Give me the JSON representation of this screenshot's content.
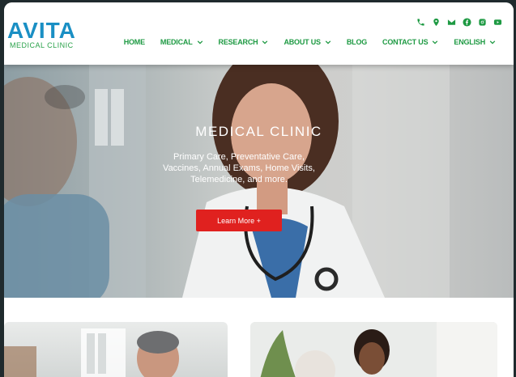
{
  "brand": {
    "logo_top": "AVITA",
    "logo_bottom": "MEDICAL CLINIC",
    "primary_color": "#1a8fc4",
    "accent_color": "#1e9a43"
  },
  "header": {
    "social_icons": [
      "phone-icon",
      "map-pin-icon",
      "mail-icon",
      "facebook-icon",
      "instagram-icon",
      "youtube-icon"
    ],
    "nav": [
      {
        "label": "HOME",
        "dropdown": false
      },
      {
        "label": "MEDICAL",
        "dropdown": true
      },
      {
        "label": "RESEARCH",
        "dropdown": true
      },
      {
        "label": "ABOUT US",
        "dropdown": true
      },
      {
        "label": "BLOG",
        "dropdown": false
      },
      {
        "label": "CONTACT US",
        "dropdown": true
      },
      {
        "label": "ENGLISH",
        "dropdown": true
      }
    ]
  },
  "hero": {
    "title": "MEDICAL CLINIC",
    "subtitle": "Primary Care, Preventative Care, Vaccines, Annual Exams, Home Visits, Telemedicine, and more.",
    "button_label": "Learn More +",
    "button_color": "#e0211f"
  }
}
